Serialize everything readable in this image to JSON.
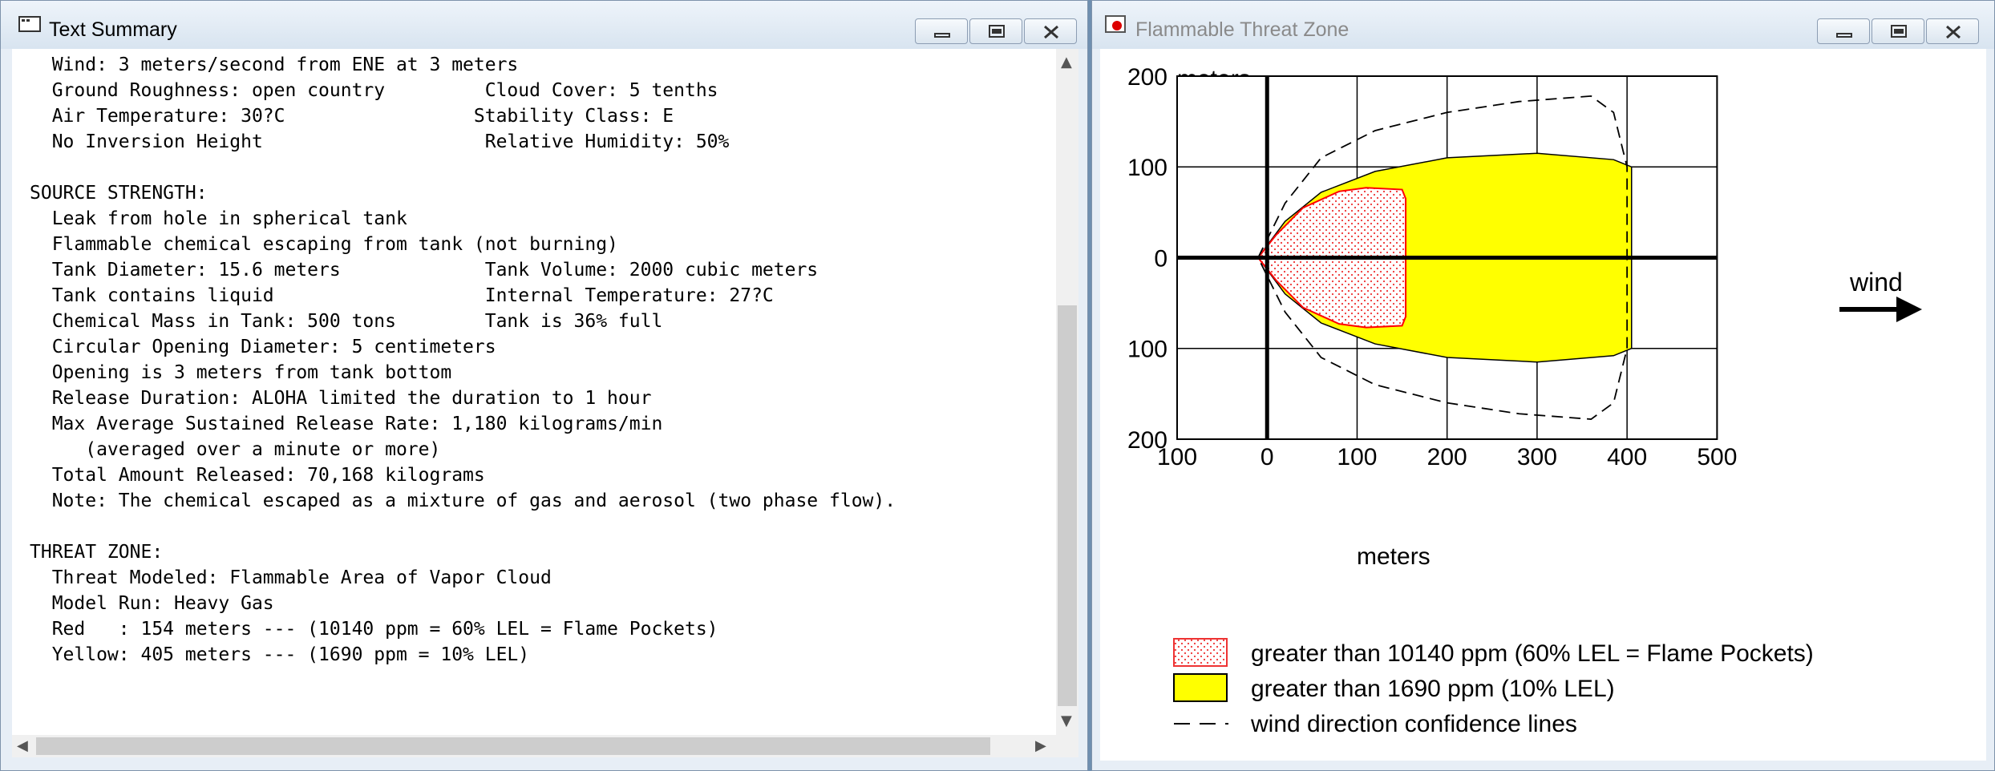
{
  "left_window": {
    "title": "Text Summary",
    "lines": [
      "  Wind: 3 meters/second from ENE at 3 meters",
      "  Ground Roughness: open country         Cloud Cover: 5 tenths",
      "  Air Temperature: 30?C                 Stability Class: E",
      "  No Inversion Height                    Relative Humidity: 50%",
      "",
      "SOURCE STRENGTH:",
      "  Leak from hole in spherical tank",
      "  Flammable chemical escaping from tank (not burning)",
      "  Tank Diameter: 15.6 meters             Tank Volume: 2000 cubic meters",
      "  Tank contains liquid                   Internal Temperature: 27?C",
      "  Chemical Mass in Tank: 500 tons        Tank is 36% full",
      "  Circular Opening Diameter: 5 centimeters",
      "  Opening is 3 meters from tank bottom",
      "  Release Duration: ALOHA limited the duration to 1 hour",
      "  Max Average Sustained Release Rate: 1,180 kilograms/min",
      "     (averaged over a minute or more)",
      "  Total Amount Released: 70,168 kilograms",
      "  Note: The chemical escaped as a mixture of gas and aerosol (two phase flow).",
      "",
      "THREAT ZONE:",
      "  Threat Modeled: Flammable Area of Vapor Cloud",
      "  Model Run: Heavy Gas",
      "  Red   : 154 meters --- (10140 ppm = 60% LEL = Flame Pockets)",
      "  Yellow: 405 meters --- (1690 ppm = 10% LEL)"
    ]
  },
  "right_window": {
    "title": "Flammable Threat Zone",
    "wind_label": "wind"
  },
  "chart_data": {
    "type": "area",
    "xlabel": "meters",
    "ylabel": "meters",
    "xlim": [
      -100,
      500
    ],
    "ylim": [
      -200,
      200
    ],
    "x_ticks": [
      "100",
      "0",
      "100",
      "200",
      "300",
      "400",
      "500"
    ],
    "y_ticks": [
      "200",
      "100",
      "0",
      "100",
      "200"
    ],
    "grid": true,
    "series": [
      {
        "name": "greater than 10140 ppm (60% LEL = Flame Pockets)",
        "color": "#ff0000",
        "fill": "dotted-red",
        "x": [
          -10,
          10,
          40,
          80,
          110,
          150,
          154,
          154,
          150,
          110,
          80,
          40,
          10,
          -10
        ],
        "y": [
          0,
          25,
          55,
          73,
          77,
          75,
          65,
          -65,
          -75,
          -77,
          -73,
          -55,
          -25,
          0
        ]
      },
      {
        "name": "greater than 1690 ppm (10% LEL)",
        "color": "#ffff00",
        "x": [
          -10,
          20,
          60,
          120,
          200,
          300,
          385,
          405,
          405,
          385,
          300,
          200,
          120,
          60,
          20,
          -10
        ],
        "y": [
          0,
          40,
          72,
          95,
          110,
          115,
          108,
          100,
          -100,
          -108,
          -115,
          -110,
          -95,
          -72,
          -40,
          0
        ]
      },
      {
        "name": "wind direction confidence lines",
        "color": "#000000",
        "style": "dashed",
        "x": [
          -10,
          20,
          60,
          120,
          200,
          280,
          360,
          385,
          400,
          400,
          385,
          360,
          280,
          200,
          120,
          60,
          20,
          -10
        ],
        "y": [
          0,
          60,
          110,
          140,
          160,
          172,
          178,
          160,
          100,
          -100,
          -160,
          -178,
          -172,
          -160,
          -140,
          -110,
          -60,
          0
        ]
      }
    ],
    "legend": "bottom"
  }
}
